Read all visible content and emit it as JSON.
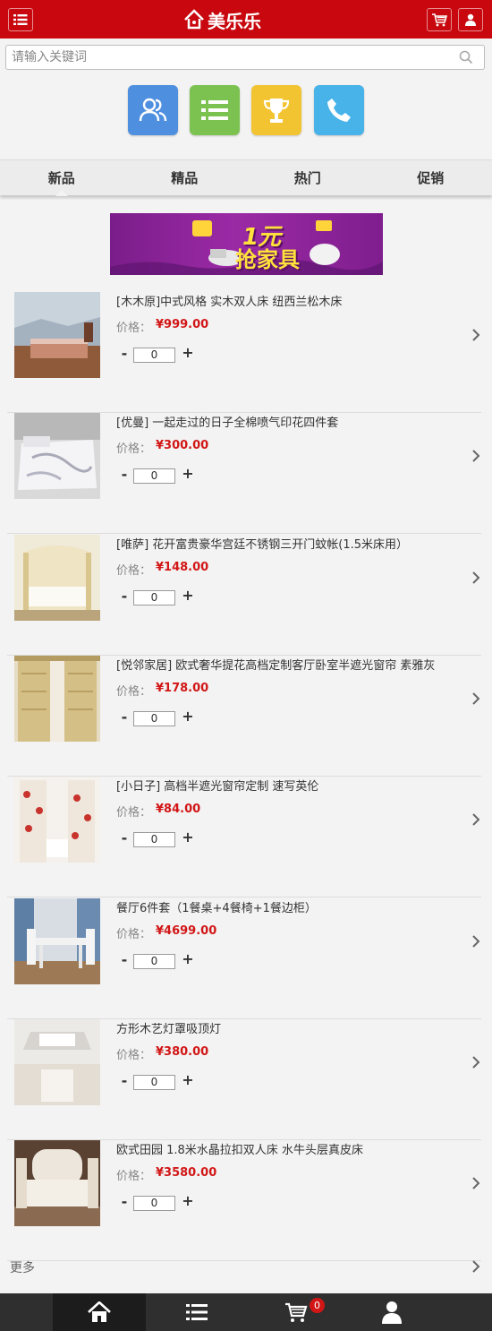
{
  "header": {
    "logo_text": "美乐乐",
    "menu_icon": "list-icon",
    "cart_icon": "cart-icon",
    "user_icon": "user-icon"
  },
  "search": {
    "placeholder": "请输入关键词",
    "icon": "search-icon"
  },
  "shortcuts": [
    {
      "icon": "users-icon",
      "color": "#4e8fe0"
    },
    {
      "icon": "list-icon",
      "color": "#7cc250"
    },
    {
      "icon": "trophy-icon",
      "color": "#f3c432"
    },
    {
      "icon": "phone-icon",
      "color": "#48b3e8"
    }
  ],
  "tabs": [
    {
      "label": "新品",
      "active": true
    },
    {
      "label": "精品",
      "active": false
    },
    {
      "label": "热门",
      "active": false
    },
    {
      "label": "促销",
      "active": false
    }
  ],
  "banner": {
    "line1": "1元",
    "line2": "抢家具"
  },
  "price_label": "价格：",
  "products": [
    {
      "title": "[木木原]中式风格 实木双人床 纽西兰松木床",
      "price": "¥999.00",
      "qty": "0"
    },
    {
      "title": "[优曼] 一起走过的日子全棉喷气印花四件套",
      "price": "¥300.00",
      "qty": "0"
    },
    {
      "title": "[唯萨] 花开富贵豪华宫廷不锈钢三开门蚊帐(1.5米床用）",
      "price": "¥148.00",
      "qty": "0"
    },
    {
      "title": "[悦邻家居] 欧式奢华提花高档定制客厅卧室半遮光窗帘 素雅灰",
      "price": "¥178.00",
      "qty": "0"
    },
    {
      "title": "[小日子] 高档半遮光窗帘定制 速写英伦",
      "price": "¥84.00",
      "qty": "0"
    },
    {
      "title": "餐厅6件套（1餐桌+4餐椅+1餐边柜）",
      "price": "¥4699.00",
      "qty": "0"
    },
    {
      "title": "方形木艺灯罩吸顶灯",
      "price": "¥380.00",
      "qty": "0"
    },
    {
      "title": "欧式田园 1.8米水晶拉扣双人床 水牛头层真皮床",
      "price": "¥3580.00",
      "qty": "0"
    }
  ],
  "more_label": "更多",
  "bottom_nav": {
    "items": [
      "home-icon",
      "list-icon",
      "cart-icon",
      "user-icon"
    ],
    "cart_count": "0"
  },
  "colors": {
    "brand_red": "#c8080e",
    "price_red": "#d21616",
    "nav_dark": "#2f2f2f"
  }
}
